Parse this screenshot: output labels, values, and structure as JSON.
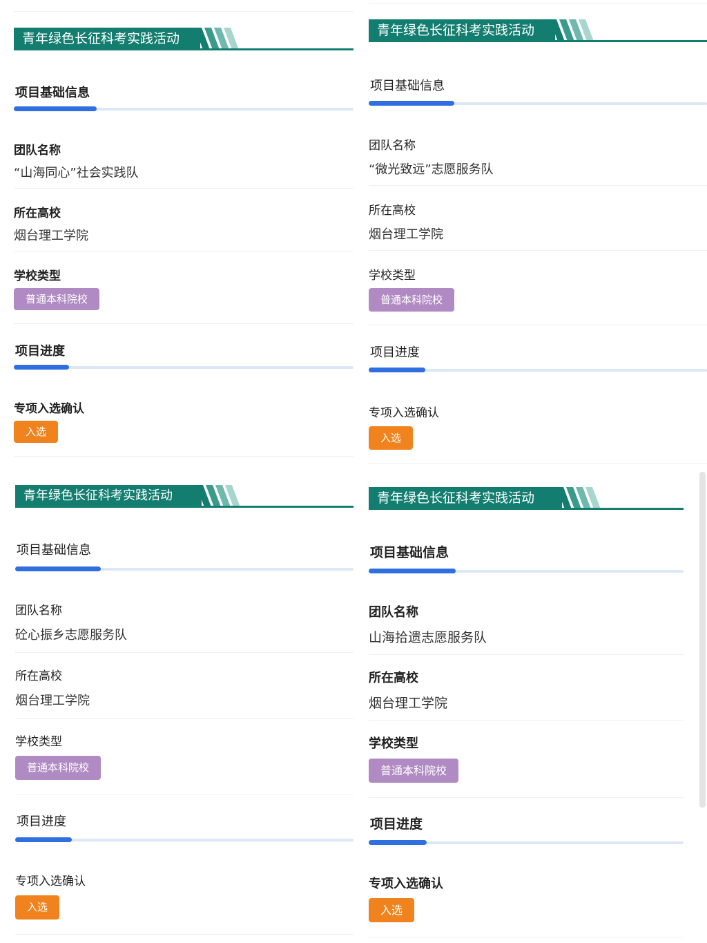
{
  "panels": [
    {
      "banner_title": "青年绿色长征科考实践活动",
      "basic_info_title": "项目基础信息",
      "team_label": "团队名称",
      "team_value": "“山海同心”社会实践队",
      "school_label": "所在高校",
      "school_value": "烟台理工学院",
      "type_label": "学校类型",
      "type_value": "普通本科院校",
      "progress_title": "项目进度",
      "confirm_label": "专项入选确认",
      "confirm_value": "入选"
    },
    {
      "banner_title": "青年绿色长征科考实践活动",
      "basic_info_title": "项目基础信息",
      "team_label": "团队名称",
      "team_value": "“微光致远”志愿服务队",
      "school_label": "所在高校",
      "school_value": "烟台理工学院",
      "type_label": "学校类型",
      "type_value": "普通本科院校",
      "progress_title": "项目进度",
      "confirm_label": "专项入选确认",
      "confirm_value": "入选"
    },
    {
      "banner_title": "青年绿色长征科考实践活动",
      "basic_info_title": "项目基础信息",
      "team_label": "团队名称",
      "team_value": "砼心振乡志愿服务队",
      "school_label": "所在高校",
      "school_value": "烟台理工学院",
      "type_label": "学校类型",
      "type_value": "普通本科院校",
      "progress_title": "项目进度",
      "confirm_label": "专项入选确认",
      "confirm_value": "入选"
    },
    {
      "banner_title": "青年绿色长征科考实践活动",
      "basic_info_title": "项目基础信息",
      "team_label": "团队名称",
      "team_value": "山海拾遗志愿服务队",
      "school_label": "所在高校",
      "school_value": "烟台理工学院",
      "type_label": "学校类型",
      "type_value": "普通本科院校",
      "progress_title": "项目进度",
      "confirm_label": "专项入选确认",
      "confirm_value": "入选"
    }
  ],
  "colors": {
    "banner": "#137e70",
    "progress_fill": "#2f6fe0",
    "progress_track": "#dde8f6",
    "school_type_badge": "#b08ac3",
    "selected_badge": "#f0831e"
  }
}
